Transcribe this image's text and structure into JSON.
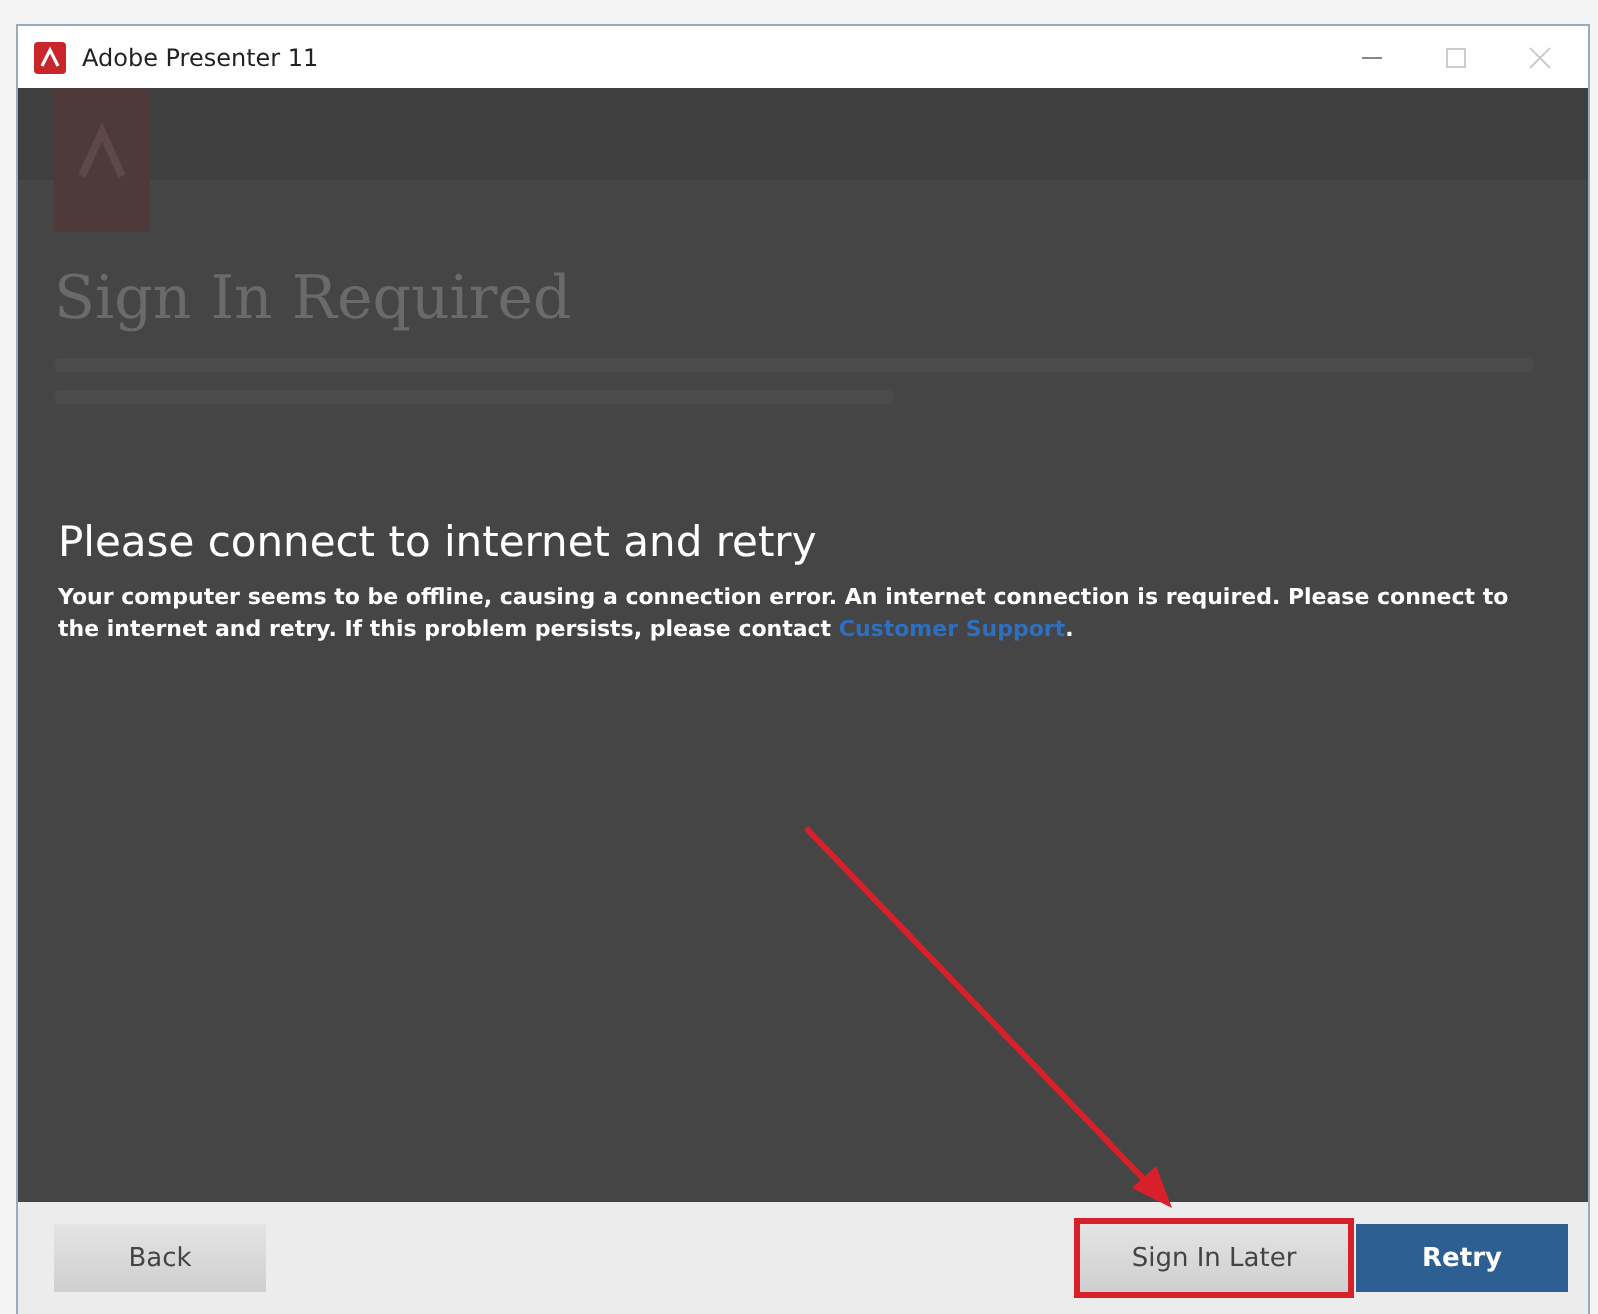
{
  "window": {
    "title": "Adobe Presenter 11"
  },
  "background": {
    "title": "Sign In Required"
  },
  "message": {
    "title": "Please connect to internet and retry",
    "text": "Your computer seems to be offline, causing a connection error. An internet connection is required. Please connect to the internet and retry. If this problem persists, please contact ",
    "link": "Customer Support",
    "tail": "."
  },
  "buttons": [
    {
      "label": "Back",
      "kind": "secondary",
      "highlighted": false
    },
    {
      "label": "Sign In Later",
      "kind": "secondary",
      "highlighted": true
    },
    {
      "label": "Retry",
      "kind": "primary",
      "highlighted": false
    }
  ]
}
